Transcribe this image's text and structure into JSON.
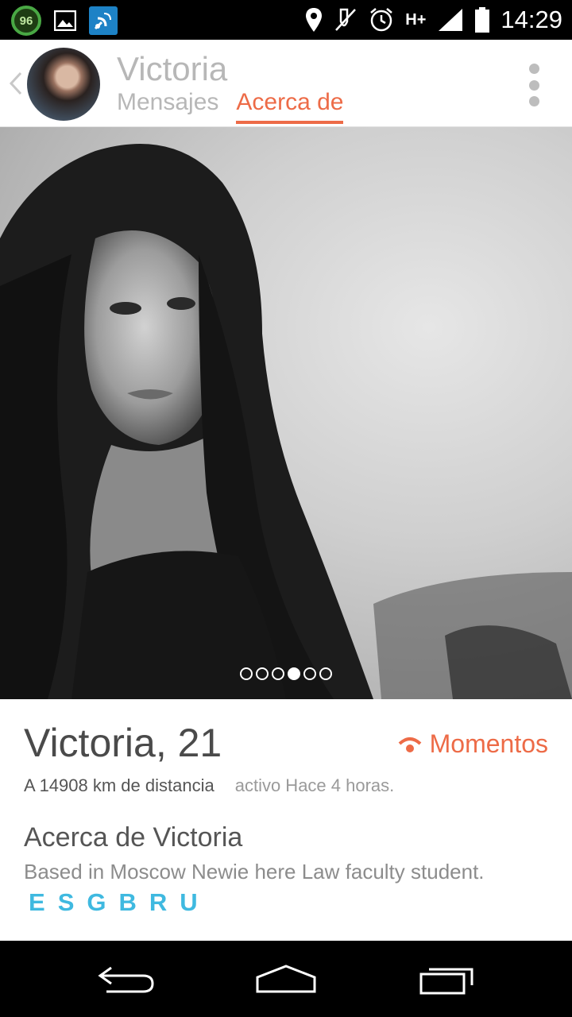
{
  "status_bar": {
    "battery_badge": "96",
    "network": "H+",
    "time": "14:29",
    "icons": [
      "battery-saver-badge-icon",
      "gallery-icon",
      "satellite-icon",
      "location-icon",
      "mute-icon",
      "alarm-icon",
      "signal-icon",
      "battery-icon"
    ]
  },
  "header": {
    "title": "Victoria",
    "tabs": [
      {
        "label": "Mensajes",
        "active": false
      },
      {
        "label": "Acerca de",
        "active": true
      }
    ]
  },
  "photo": {
    "page_count": 6,
    "current_page": 4
  },
  "profile": {
    "name": "Victoria",
    "age": ", 21",
    "momentos_label": "Momentos",
    "distance": "A 14908 km de distancia",
    "active": "activo Hace 4 horas.",
    "about_title": "Acerca de Victoria",
    "about_text": "Based in Moscow Newie here Law faculty student.",
    "languages": [
      "E",
      "S",
      "G",
      "B",
      "R",
      "U"
    ]
  },
  "colors": {
    "accent": "#ed6b47",
    "language_blue": "#3fb9e0",
    "muted_text": "#b7b7b7"
  }
}
